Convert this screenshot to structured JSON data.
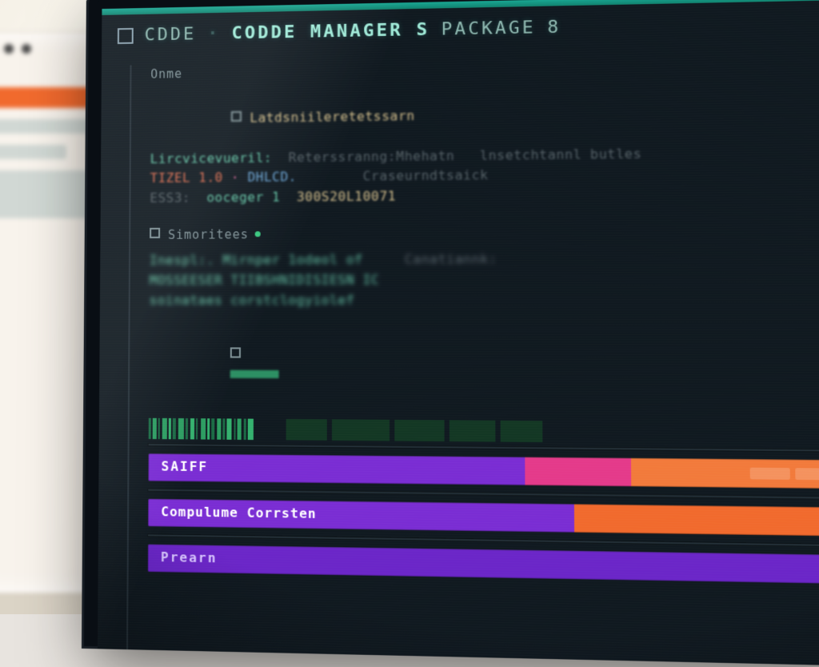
{
  "window": {
    "title_prefix": "CDDE",
    "title_main": "CODDE MANAGER S",
    "title_suffix": "PACKAGE",
    "title_trailer": "8"
  },
  "sections": {
    "name_label": "Onme",
    "line1_key": "Latdsniileretetssarn",
    "line2_key": "Lircvicevueril:",
    "line2_mid": "Reterssranng:Mhehatn",
    "line2_tail": "lnsetchtannl butles",
    "line3_a": "TIZEL 1.0",
    "line3_b": "DHLCD.",
    "line3_tail": "Craseurndtsaick",
    "line4_a": "ESS3:",
    "line4_b": "ooceger 1",
    "line4_c": "300S20L10071",
    "matrices_label": "Simoritees",
    "m1": "Inespl:. Mirnper 1odeol of",
    "m1_tail": "Canatiannk:",
    "m2": "MOSSEESER TIIBSHNIDISIESN IC",
    "m3": "soinataes corstclogyiolef",
    "barcode_label": "",
    "bars": {
      "saiff": "SAIFF",
      "compl": "Compulume Corrsten",
      "pean": "Prearn"
    }
  },
  "colors": {
    "teal": "#1aa592",
    "purple": "#7a2fd1",
    "magenta": "#e23b8a",
    "orange": "#ef6a2f",
    "green": "#3ac77f"
  }
}
